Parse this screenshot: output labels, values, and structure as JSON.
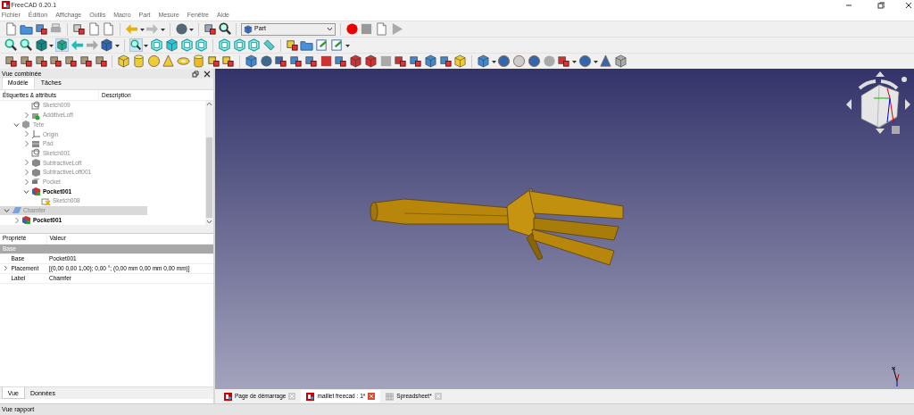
{
  "window": {
    "title": "FreeCAD 0.20.1"
  },
  "menu": [
    "Fichier",
    "Édition",
    "Affichage",
    "Outils",
    "Macro",
    "Part",
    "Mesure",
    "Fenêtre",
    "Aide"
  ],
  "workbench": {
    "value": "Part"
  },
  "combo_view": {
    "title": "Vue combinée",
    "tabs": [
      {
        "label": "Modèle",
        "selected": true
      },
      {
        "label": "Tâches",
        "selected": false
      }
    ],
    "tree": {
      "columns": [
        "Étiquettes & attributs",
        "Description"
      ],
      "items": [
        {
          "children": [
            {
              "children": [
                {
                  "label": "Sketch009",
                  "kind": "sketch",
                  "visible": false,
                  "selected": false
                },
                {
                  "label": "AdditiveLoft",
                  "kind": "loft_add",
                  "visible": false,
                  "selected": false,
                  "expanded": false
                }
              ]
            },
            {
              "label": "Tete",
              "kind": "body",
              "visible": false,
              "selected": false,
              "expanded": true,
              "children": [
                {
                  "label": "Origin",
                  "kind": "origin",
                  "visible": false,
                  "selected": false,
                  "expanded": false
                },
                {
                  "label": "Pad",
                  "kind": "pad",
                  "visible": false,
                  "selected": false,
                  "expanded": false
                },
                {
                  "label": "Sketch001",
                  "kind": "sketch",
                  "visible": false,
                  "selected": false
                },
                {
                  "label": "SubtractiveLoft",
                  "kind": "loft_sub",
                  "visible": false,
                  "selected": false,
                  "expanded": false
                },
                {
                  "label": "SubtractiveLoft001",
                  "kind": "loft_sub",
                  "visible": false,
                  "selected": false,
                  "expanded": false
                },
                {
                  "label": "Pocket",
                  "kind": "pocket",
                  "visible": false,
                  "selected": false,
                  "expanded": false
                },
                {
                  "label": "Pocket001",
                  "kind": "pocket_active",
                  "visible": true,
                  "selected": false,
                  "expanded": true,
                  "children": [
                    {
                      "label": "Sketch008",
                      "kind": "sketch_attached",
                      "visible": false,
                      "selected": false
                    }
                  ]
                }
              ]
            }
          ]
        },
        {
          "label": "Chamfer",
          "kind": "chamfer",
          "visible": false,
          "selected": true,
          "expanded": true,
          "children": [
            {
              "label": "Pocket001",
              "kind": "pocket_active",
              "visible": true,
              "selected": false,
              "expanded": false
            }
          ]
        }
      ]
    },
    "properties": {
      "columns": [
        "Propriété",
        "Valeur"
      ],
      "group": "Base",
      "rows": [
        {
          "name": "Base",
          "value": "Pocket001"
        },
        {
          "name": "Placement",
          "value": "[(0,00 0,00 1,00); 0,00 °; (0,00 mm  0,00 mm  0,00 mm)]",
          "expanded": false
        },
        {
          "name": "Label",
          "value": "Chamfer"
        }
      ]
    },
    "bottom_tabs": [
      {
        "label": "Vue",
        "selected": true
      },
      {
        "label": "Données",
        "selected": false
      }
    ]
  },
  "document_tabs": [
    {
      "label": "Page de démarrage",
      "kind": "freecad",
      "selected": false
    },
    {
      "label": "maillet freecad : 1*",
      "kind": "freecad",
      "selected": true
    },
    {
      "label": "Spreadsheet*",
      "kind": "spreadsheet",
      "selected": false
    }
  ],
  "report_view": {
    "title": "Vue rapport"
  }
}
